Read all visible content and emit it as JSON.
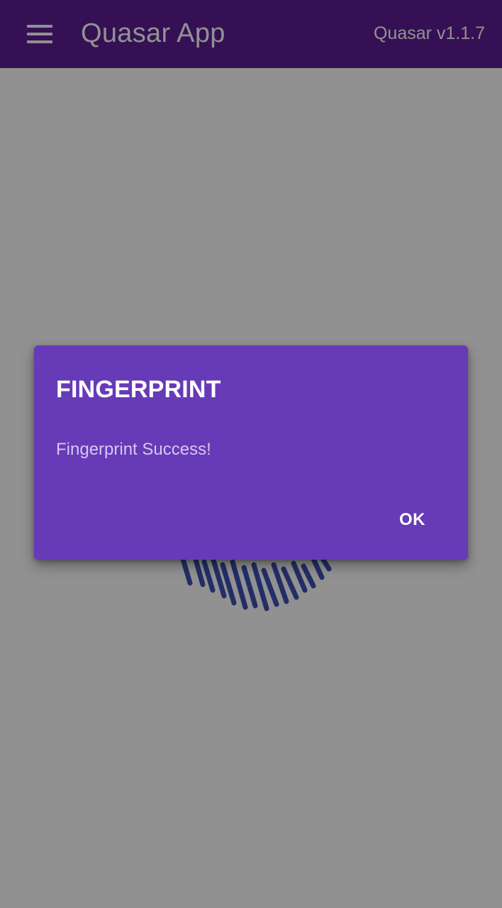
{
  "app_bar": {
    "menu_icon": "hamburger-menu-icon",
    "title": "Quasar App",
    "version": "Quasar v1.1.7",
    "background": "#5e1d96"
  },
  "main": {
    "fingerprint_icon": "fingerprint-icon",
    "fingerprint_color": "#3f51b5"
  },
  "dialog": {
    "title": "FINGERPRINT",
    "message": "Fingerprint Success!",
    "ok_label": "OK",
    "background": "#673ab7"
  }
}
